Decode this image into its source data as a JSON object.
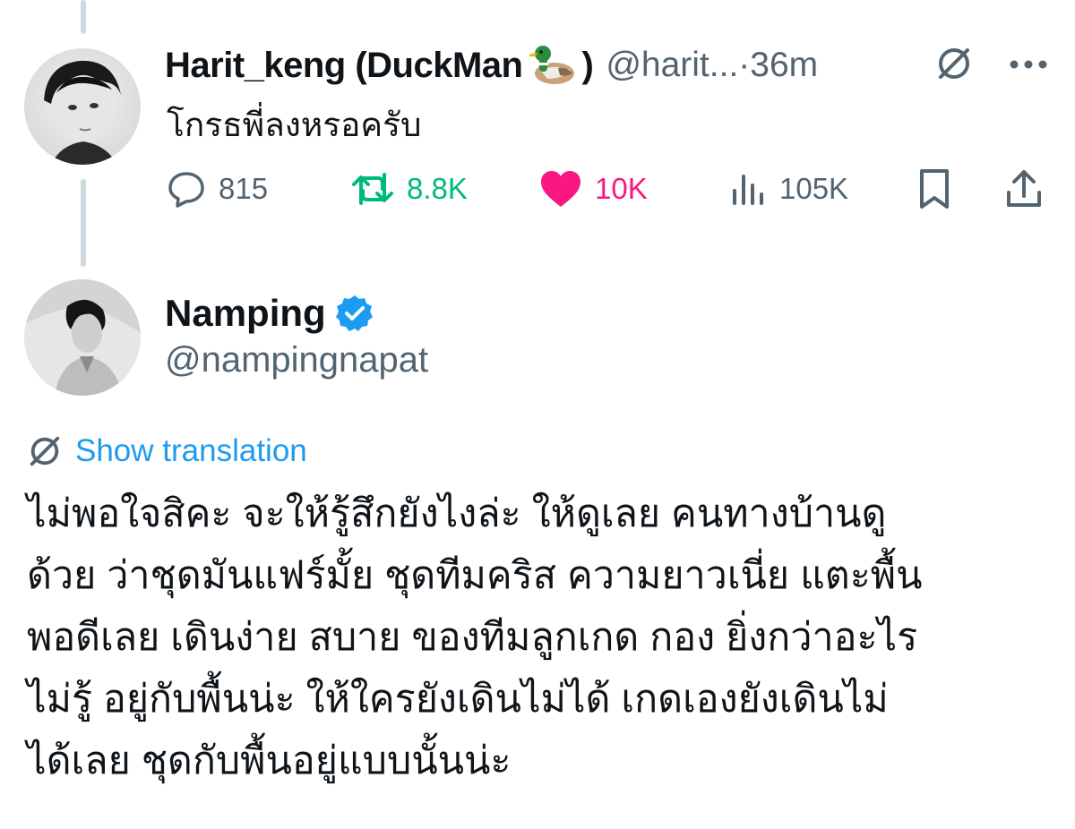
{
  "parent_tweet": {
    "display_name": "Harit_keng (DuckMan",
    "display_name_end": ")",
    "emoji": "duck-emoji",
    "handle": "@harit...",
    "separator": "·",
    "time": "36m",
    "text": "โกรธพี่ลงหรอครับ",
    "stats": {
      "replies": "815",
      "retweets": "8.8K",
      "likes": "10K",
      "views": "105K"
    },
    "colors": {
      "retweet": "#00ba7c",
      "like": "#f91880",
      "muted": "#536471"
    }
  },
  "main_tweet": {
    "display_name": "Namping",
    "handle": "@nampingnapat",
    "verified_color": "#1d9bf0",
    "translate_label": "Show translation",
    "lines": [
      "ไม่พอใจสิคะ จะให้รู้สึกยังไงล่ะ ให้ดูเลย คนทางบ้านดู",
      "ด้วย ว่าชุดมันแฟร์มั้ย ชุดทีมคริส ความยาวเนี่ย แตะพื้น",
      "พอดีเลย เดินง่าย สบาย ของทีมลูกเกด กอง ยิ่งกว่าอะไร",
      "ไม่รู้ อยู่กับพื้นน่ะ ให้ใครยังเดินไม่ได้ เกดเองยังเดินไม่",
      "ได้เลย ชุดกับพื้นอยู่แบบนั้นน่ะ"
    ]
  },
  "icons": {
    "grok": "grok-icon",
    "more": "more-icon",
    "reply": "reply-icon",
    "retweet": "retweet-icon",
    "like": "heart-icon",
    "views": "views-icon",
    "bookmark": "bookmark-icon",
    "share": "share-icon",
    "verified": "verified-badge-icon",
    "translate": "translate-icon"
  }
}
